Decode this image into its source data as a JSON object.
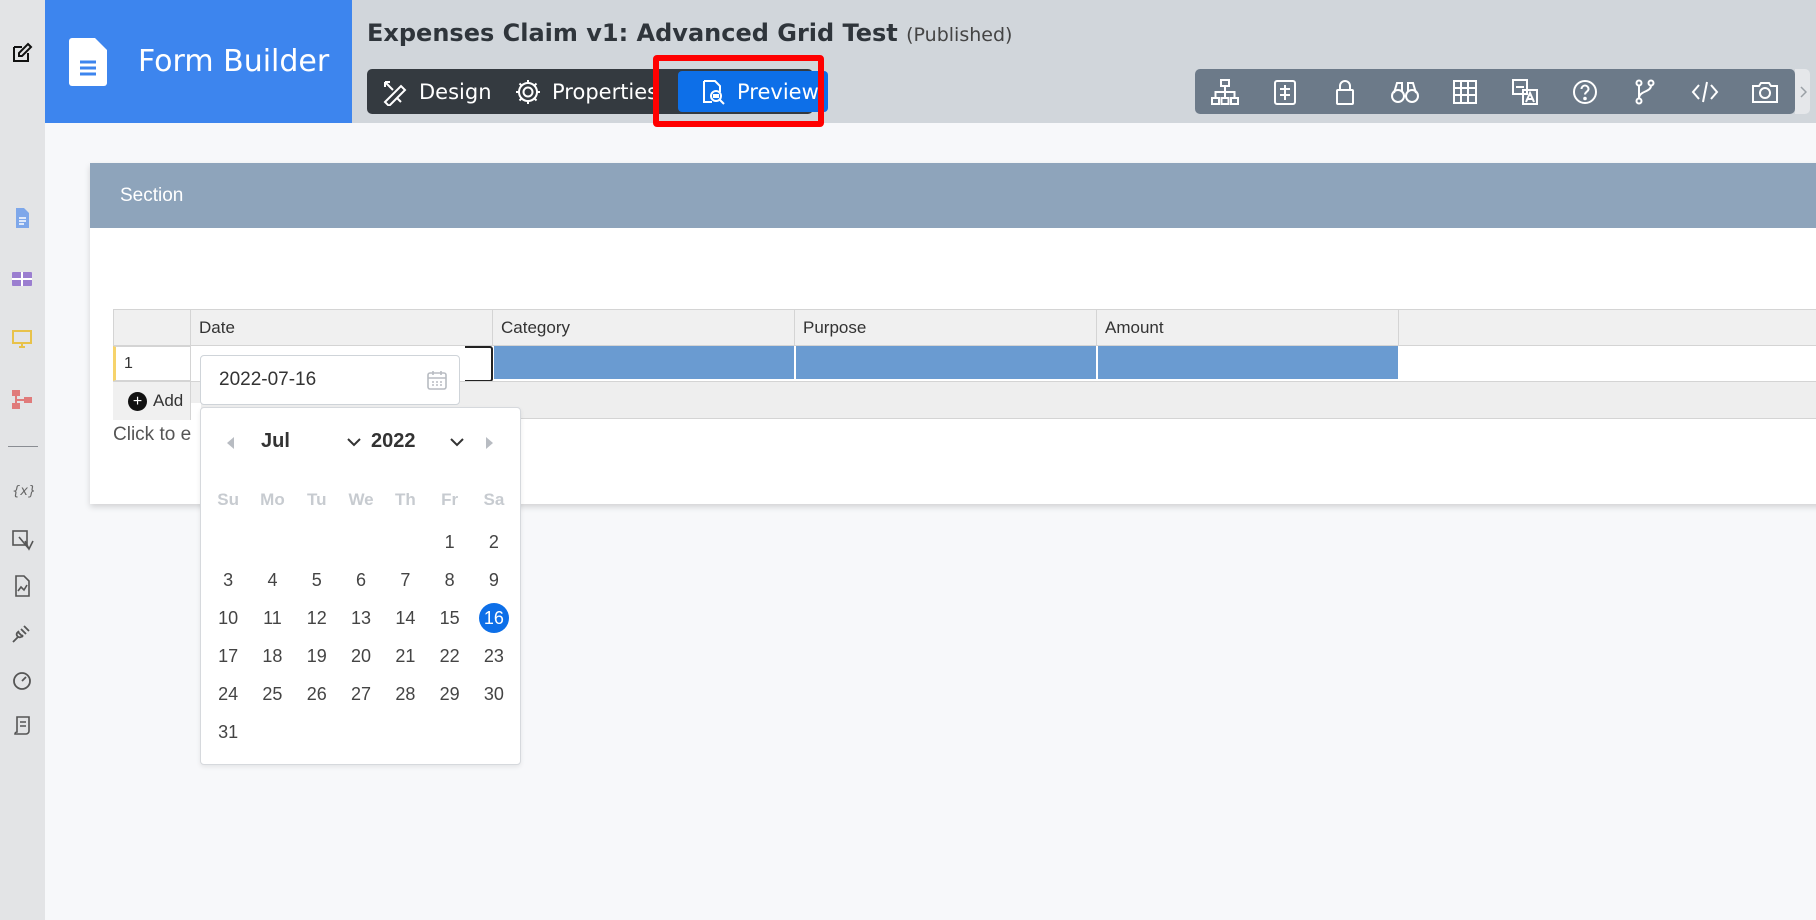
{
  "app": {
    "title": "Form Builder"
  },
  "form": {
    "title": "Expenses Claim v1: Advanced Grid Test",
    "status": "(Published)"
  },
  "modes": {
    "design": "Design",
    "properties": "Properties",
    "preview": "Preview"
  },
  "toolbar_icons": [
    "sitemap-icon",
    "rules-icon",
    "lock-icon",
    "binoculars-icon",
    "table-icon",
    "translate-icon",
    "help-icon",
    "branch-icon",
    "code-icon",
    "camera-icon"
  ],
  "section": {
    "title": "Section"
  },
  "grid": {
    "columns": [
      "Date",
      "Category",
      "Purpose",
      "Amount"
    ],
    "row_number": "1",
    "add_label": "Add",
    "click_hint": "Click to e"
  },
  "datepicker": {
    "value": "2022-07-16",
    "month": "Jul",
    "year": "2022",
    "weekdays": [
      "Su",
      "Mo",
      "Tu",
      "We",
      "Th",
      "Fr",
      "Sa"
    ],
    "days": [
      "",
      "",
      "",
      "",
      "",
      "1",
      "2",
      "3",
      "4",
      "5",
      "6",
      "7",
      "8",
      "9",
      "10",
      "11",
      "12",
      "13",
      "14",
      "15",
      "16",
      "17",
      "18",
      "19",
      "20",
      "21",
      "22",
      "23",
      "24",
      "25",
      "26",
      "27",
      "28",
      "29",
      "30",
      "31"
    ],
    "selected_day": "16"
  },
  "colors": {
    "brand": "#3d85ee",
    "accent": "#0d6fe8",
    "highlight": "#ff0000",
    "section_header": "#8ea4bb",
    "selected_cells": "#6a9bd1"
  }
}
